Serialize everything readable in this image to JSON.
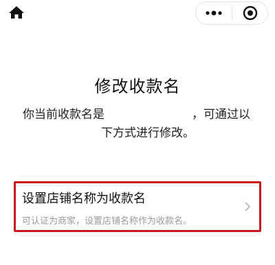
{
  "nav": {
    "home_icon": "home-icon",
    "more_icon": "more-dots-icon",
    "close_icon": "target-close-icon"
  },
  "page": {
    "title": "修改收款名",
    "desc_prefix": "你当前收款名是",
    "desc_suffix": "，可通过以",
    "desc_line2": "下方式进行修改。"
  },
  "option": {
    "title": "设置店铺名称为收款名",
    "subtitle": "可认证为商家，设置店铺名称作为收款名。",
    "highlight_color": "#c8161d"
  }
}
